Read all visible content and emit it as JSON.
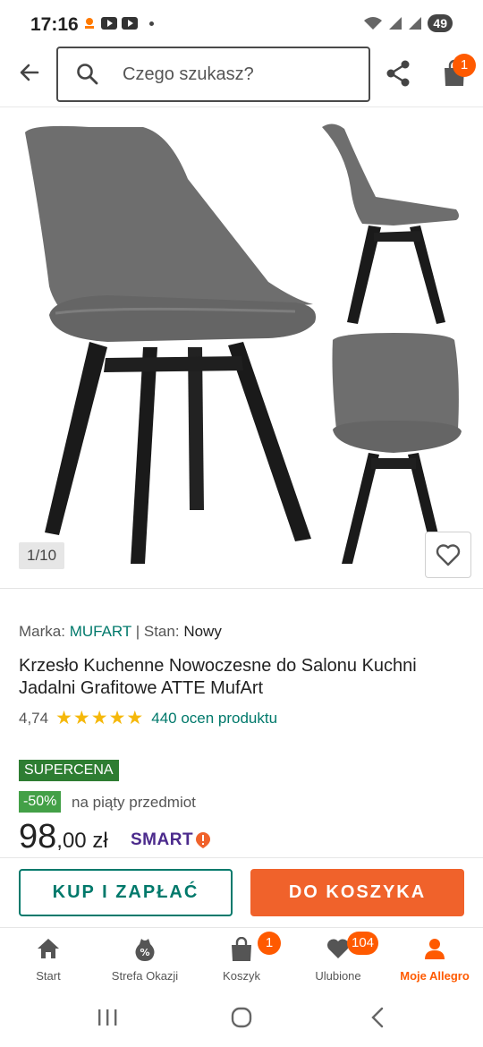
{
  "status_bar": {
    "time": "17:16",
    "battery": "49"
  },
  "search": {
    "placeholder": "Czego szukasz?"
  },
  "header": {
    "cart_count": "1"
  },
  "gallery": {
    "counter": "1/10"
  },
  "product": {
    "brand_label": "Marka:",
    "brand_value": "MUFART",
    "condition_label": "Stan:",
    "condition_value": "Nowy",
    "separator": "|",
    "title": "Krzesło Kuchenne Nowoczesne do Salonu Kuchni Jadalni Grafitowe ATTE MufArt",
    "rating": "4,74",
    "stars": "★★★★★",
    "reviews": "440 ocen produktu",
    "badge": "SUPERCENA",
    "discount": "-50%",
    "discount_text": "na piąty przedmiot",
    "price_main": "98",
    "price_rest": ",00 zł",
    "smart": "SMART"
  },
  "actions": {
    "buy": "KUP I ZAPŁAĆ",
    "add_to_cart": "DO KOSZYKA"
  },
  "bottom_nav": {
    "items": [
      {
        "label": "Start",
        "icon": "home-icon"
      },
      {
        "label": "Strefa Okazji",
        "icon": "percent-bag-icon"
      },
      {
        "label": "Koszyk",
        "icon": "cart-icon",
        "badge": "1"
      },
      {
        "label": "Ulubione",
        "icon": "heart-icon",
        "badge": "104"
      },
      {
        "label": "Moje Allegro",
        "icon": "user-icon"
      }
    ]
  },
  "colors": {
    "accent": "#ff5a00",
    "teal": "#00796b",
    "cart_button": "#f0622b",
    "supercena": "#2e7d32",
    "discount": "#43a047",
    "smart": "#4b2a8c"
  }
}
